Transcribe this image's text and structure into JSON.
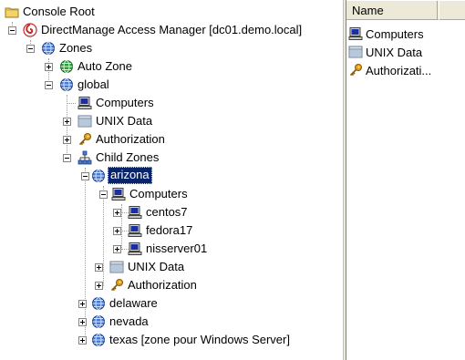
{
  "tree": {
    "console_root": "Console Root",
    "dma": "DirectManage Access Manager [dc01.demo.local]",
    "zones": "Zones",
    "auto_zone": "Auto Zone",
    "global": "global",
    "global_computers": "Computers",
    "global_unix_data": "UNIX Data",
    "global_authorization": "Authorization",
    "child_zones": "Child Zones",
    "arizona": "arizona",
    "arizona_computers": "Computers",
    "centos7": "centos7",
    "fedora17": "fedora17",
    "nisserver01": "nisserver01",
    "arizona_unix_data": "UNIX Data",
    "arizona_authorization": "Authorization",
    "delaware": "delaware",
    "nevada": "nevada",
    "texas": "texas [zone pour Windows Server]"
  },
  "list": {
    "column_name": "Name",
    "items": [
      "Computers",
      "UNIX Data",
      "Authorizati..."
    ]
  },
  "colors": {
    "selection": "#0a246a",
    "globe_blue": "#4a7bd0",
    "globe_green": "#2e9e3e",
    "folder_yellow": "#f3d46b",
    "key_gold": "#e0a020"
  }
}
